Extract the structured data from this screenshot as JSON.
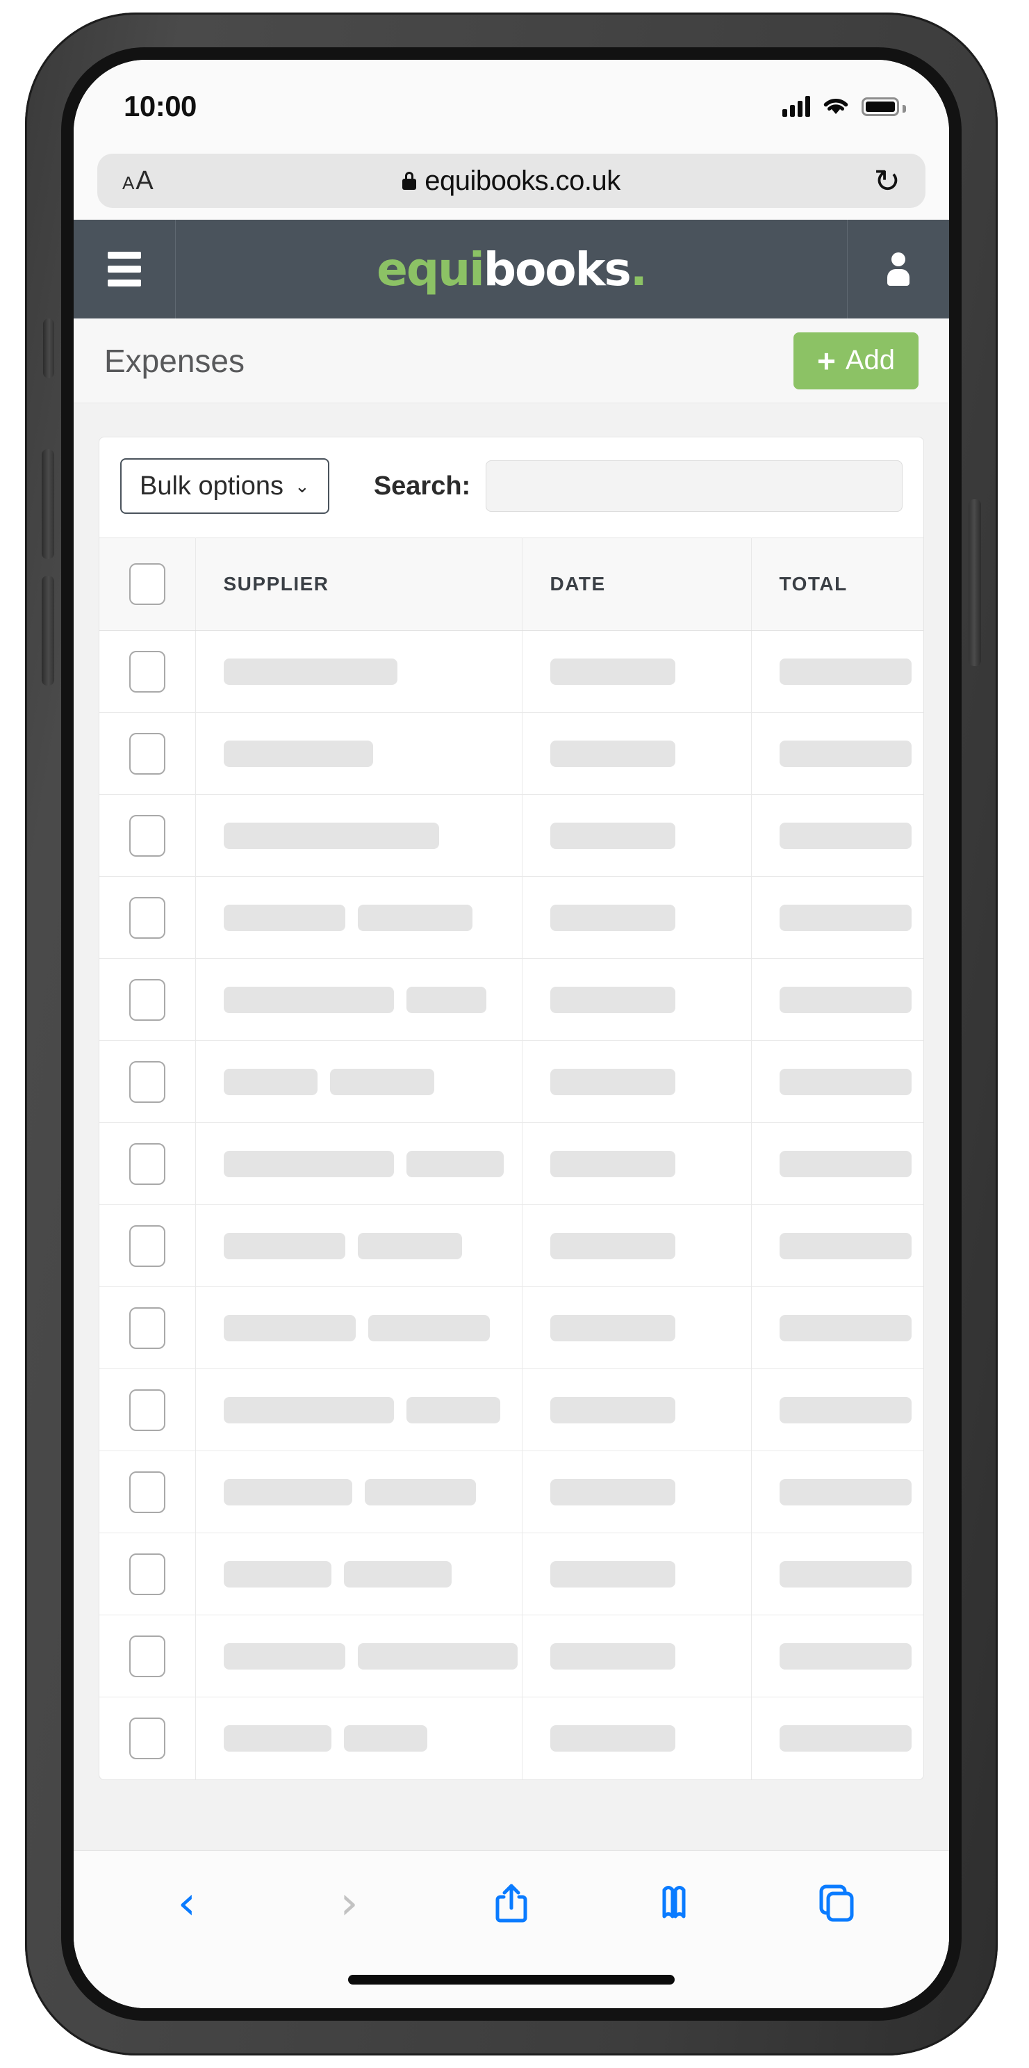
{
  "status_bar": {
    "time": "10:00",
    "signal_icon": "cellular-signal-icon",
    "wifi_icon": "wifi-icon",
    "battery_icon": "battery-full-icon"
  },
  "browser": {
    "text_size_label": "AA",
    "lock_icon": "lock-icon",
    "url": "equibooks.co.uk",
    "reload_icon": "reload-icon",
    "bottom_toolbar": [
      {
        "name": "back-button",
        "glyph": "‹",
        "state": "enabled"
      },
      {
        "name": "forward-button",
        "glyph": "›",
        "state": "disabled"
      },
      {
        "name": "share-button",
        "glyph": "share-icon",
        "state": "enabled"
      },
      {
        "name": "bookmarks-button",
        "glyph": "book-icon",
        "state": "enabled"
      },
      {
        "name": "tabs-button",
        "glyph": "tabs-icon",
        "state": "enabled"
      }
    ]
  },
  "app_header": {
    "menu_icon": "hamburger-menu-icon",
    "logo_part_green": "equi",
    "logo_part_white": "books",
    "logo_dot": ".",
    "account_icon": "user-account-icon",
    "background_color": "#4a535c",
    "accent_color": "#8cc265"
  },
  "page": {
    "title": "Expenses",
    "add_button_label": "Add",
    "add_button_icon": "+",
    "add_button_color": "#8cc265"
  },
  "toolbar": {
    "bulk_options_label": "Bulk options",
    "bulk_options_caret": "⌄",
    "search_label": "Search:",
    "search_value": "",
    "search_placeholder": ""
  },
  "table": {
    "columns": [
      "",
      "SUPPLIER",
      "DATE",
      "TOTAL"
    ],
    "select_all_checkbox": "unchecked",
    "loading_state": "skeleton-placeholders",
    "rows": [
      {
        "supplier": [
          250
        ],
        "date": [
          180
        ],
        "total": [
          190
        ]
      },
      {
        "supplier": [
          215
        ],
        "date": [
          180
        ],
        "total": [
          190
        ]
      },
      {
        "supplier": [
          310
        ],
        "date": [
          180
        ],
        "total": [
          190
        ]
      },
      {
        "supplier": [
          175,
          165
        ],
        "date": [
          180
        ],
        "total": [
          190
        ]
      },
      {
        "supplier": [
          245,
          115
        ],
        "date": [
          180
        ],
        "total": [
          190
        ]
      },
      {
        "supplier": [
          135,
          150
        ],
        "date": [
          180
        ],
        "total": [
          190
        ]
      },
      {
        "supplier": [
          245,
          140
        ],
        "date": [
          180
        ],
        "total": [
          190
        ]
      },
      {
        "supplier": [
          175,
          150
        ],
        "date": [
          180
        ],
        "total": [
          190
        ]
      },
      {
        "supplier": [
          190,
          175
        ],
        "date": [
          180
        ],
        "total": [
          190
        ]
      },
      {
        "supplier": [
          245,
          135
        ],
        "date": [
          180
        ],
        "total": [
          190
        ]
      },
      {
        "supplier": [
          185,
          160
        ],
        "date": [
          180
        ],
        "total": [
          190
        ]
      },
      {
        "supplier": [
          155,
          155
        ],
        "date": [
          180
        ],
        "total": [
          190
        ]
      },
      {
        "supplier": [
          175,
          230
        ],
        "date": [
          180
        ],
        "total": [
          190
        ]
      },
      {
        "supplier": [
          155,
          120
        ],
        "date": [
          180
        ],
        "total": [
          190
        ]
      }
    ]
  }
}
